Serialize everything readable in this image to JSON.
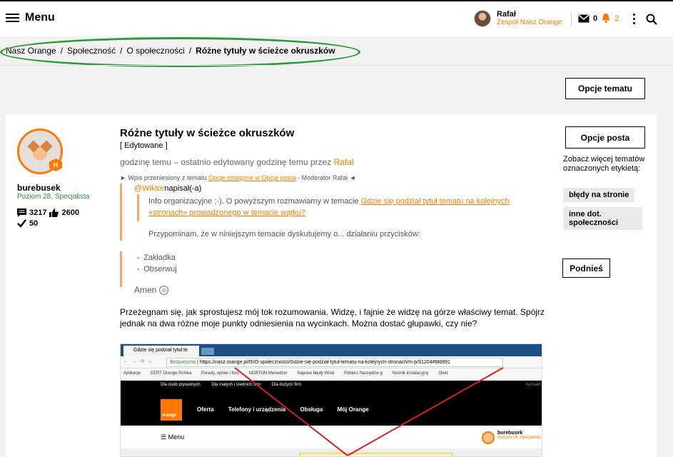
{
  "header": {
    "menu_label": "Menu",
    "user_name": "Rafał",
    "user_team": "Zespół Nasz Orange",
    "messages_count": "0",
    "notifications_count": "2"
  },
  "breadcrumb": {
    "items": [
      "Nasz Orange",
      "Społeczność",
      "O społeczności"
    ],
    "current": "Różne tytuły w ścieżce okruszków",
    "separator": "/"
  },
  "buttons": {
    "topic_options": "Opcje tematu",
    "post_options": "Opcje posta",
    "bump": "Podnieś"
  },
  "author": {
    "name": "burebusek",
    "rank": "Poziom 28, Specjalista",
    "badge": "H",
    "messages": "3217",
    "likes": "2600",
    "solutions": "50"
  },
  "post": {
    "title": "Różne tytuły w ścieżce okruszków",
    "edited_tag": "[ Edytowane ]",
    "edit_meta_prefix": "godzinę temu – ostatnio edytowany godzinę temu przez ",
    "edited_by": "Rafał",
    "moved_prefix": "► Wpis przeniesiony z tematu ",
    "moved_link": "Opcje dostępne w Opcje posta",
    "moved_suffix": " - Moderator Rafał ◄",
    "mention_user": "@Wiktor",
    "mention_suffix": "napisał(-a)",
    "quote_p1_prefix": "Info organizacyjne ;-). O powyższym rozmawiamy w temacie ",
    "quote_p1_link": "Gdzie się podział tytuł tematu na kolejnych «stronach» prowadzonego w temacie wątku?",
    "quote_p2": "Przypominam, że w niniejszym temacie dyskutujemy o... działaniu przycisków:",
    "quote_list": [
      "Zakładka",
      "Obserwuj"
    ],
    "amen": "Amen",
    "reply": "Przeżegnam się, jak sprostujesz mój tok rozumowania. Widzę, i fajnie że widzę na górze właściwy temat. Spójrz jednak na dwa różne moje punkty odniesienia na wycinkach. Można dostać głupawki, czy nie?"
  },
  "screenshot": {
    "tab_title": "Gdzie się podział tytuł te",
    "secure_label": "Bezpieczna",
    "url": "https://nasz.orange.pl/t5/O-społeczności/Gdzie-się-podział-tytuł-tematu-na-kolejnych-stronach/m-p/91204#M8891",
    "bookmarks": [
      "Aplikacje",
      "CERT Orange Polska",
      "Porady, opinie i foru",
      "NORTON Menedżer",
      "Napraw błędy Wind",
      "Pobierz Narzędzie g",
      "Nośnik instalacyjny",
      "Onet"
    ],
    "top_links": [
      "Dla osób prywatnych",
      "Dla małych i średnich firm",
      "Dla dużych firm"
    ],
    "contact": "Kontakt",
    "logo": "orange",
    "main_menu": [
      "Oferta",
      "Telefony i urządzenia",
      "Obsługa",
      "Mój Orange"
    ],
    "sub_menu": "Menu",
    "user": "burebusek",
    "user_rank": "Poziom 28, Specjalista"
  },
  "sidebar": {
    "tags_label": "Zobacz więcej tematów oznaczonych etykietą:",
    "tags": [
      "błędy na stronie",
      "inne dot. społeczności"
    ]
  },
  "colors": {
    "accent": "#ff7900",
    "annotation": "#2e9a3a",
    "arrow": "#d32020"
  }
}
